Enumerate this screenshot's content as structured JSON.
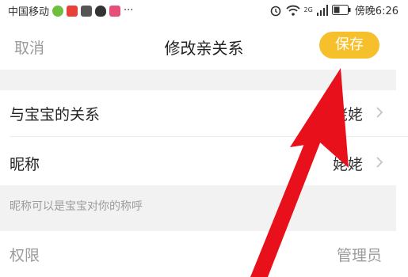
{
  "status_bar": {
    "carrier": "中国移动",
    "more": "···",
    "wifi_label": "2G",
    "time": "傍晚6:26"
  },
  "nav": {
    "cancel": "取消",
    "title": "修改亲关系",
    "save": "保存"
  },
  "rows": {
    "relation": {
      "label": "与宝宝的关系",
      "value": "姥姥"
    },
    "nickname": {
      "label": "昵称",
      "value": "姥姥"
    }
  },
  "hint": "昵称可以是宝宝对你的称呼",
  "permission": {
    "label": "权限",
    "value": "管理员"
  },
  "colors": {
    "accent": "#f6c02c",
    "annotation_arrow": "#e8101a",
    "band": "#f2f2f2"
  }
}
